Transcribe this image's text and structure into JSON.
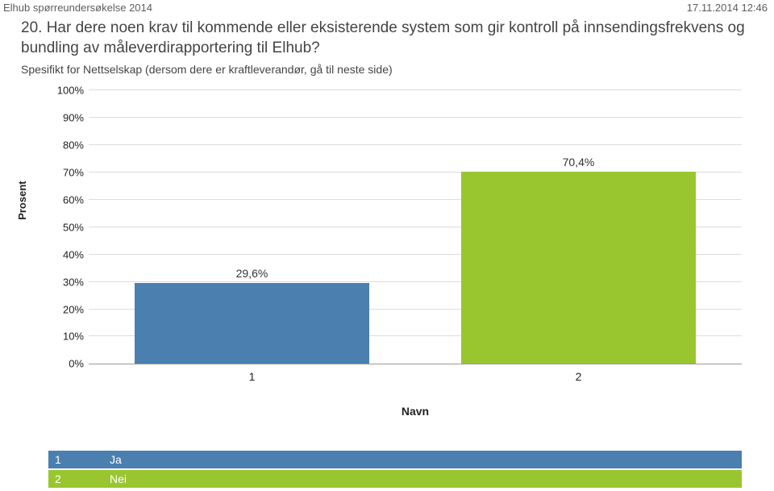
{
  "header": {
    "survey_name": "Elhub spørreundersøkelse 2014",
    "timestamp": "17.11.2014 12:46"
  },
  "question": {
    "title": "20. Har dere noen krav til kommende eller eksisterende system som gir kontroll på innsendingsfrekvens og bundling av måleverdirapportering til Elhub?",
    "subtitle": "Spesifikt for Nettselskap (dersom dere er kraftleverandør, gå til neste side)"
  },
  "chart_data": {
    "type": "bar",
    "ylabel": "Prosent",
    "xlabel": "Navn",
    "categories": [
      "1",
      "2"
    ],
    "values": [
      29.6,
      70.4
    ],
    "value_labels": [
      "29,6%",
      "70,4%"
    ],
    "ylim": [
      0,
      100
    ],
    "y_ticks": [
      "0%",
      "10%",
      "20%",
      "30%",
      "40%",
      "50%",
      "60%",
      "70%",
      "80%",
      "90%",
      "100%"
    ],
    "legend": [
      {
        "key": "1",
        "label": "Ja"
      },
      {
        "key": "2",
        "label": "Nei"
      }
    ]
  }
}
